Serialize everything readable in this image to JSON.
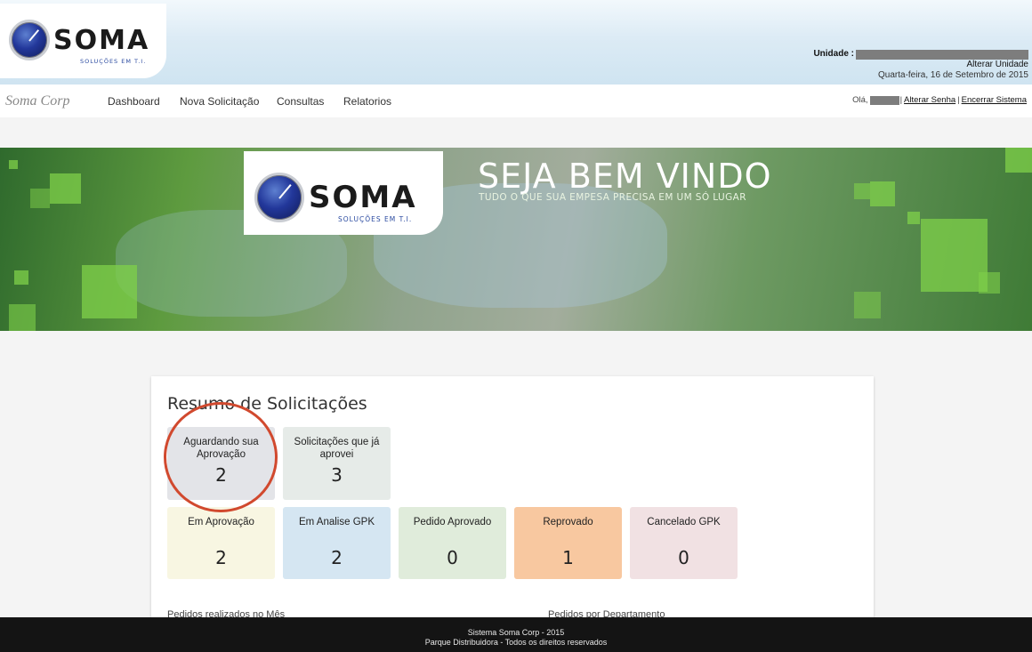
{
  "header": {
    "logo": {
      "word": "SOMA",
      "tagline": "SOLUÇÕES EM T.I."
    },
    "unit_label": "Unidade :",
    "change_unit": "Alterar Unidade",
    "date": "Quarta-feira, 16 de Setembro de 2015"
  },
  "nav": {
    "brand": "Soma Corp",
    "items": [
      {
        "label": "Dashboard"
      },
      {
        "label": "Nova Solicitação"
      },
      {
        "label": "Consultas"
      },
      {
        "label": "Relatorios"
      }
    ],
    "greeting": "Olá,",
    "separator": "|",
    "change_password": "Alterar Senha",
    "logout": "Encerrar Sistema"
  },
  "hero": {
    "logo": {
      "word": "SOMA",
      "tagline": "SOLUÇÕES EM T.I."
    },
    "title": "SEJA BEM VINDO",
    "subtitle": "TUDO O QUE SUA EMPESA PRECISA EM UM SÓ LUGAR"
  },
  "summary": {
    "title": "Resumo de Solicitações",
    "tiles": [
      {
        "label": "Aguardando sua Aprovação",
        "value": "2",
        "color": "#e3e4e8"
      },
      {
        "label": "Solicitações que já aprovei",
        "value": "3",
        "color": "#e6ebe8"
      },
      {
        "label": "Em Aprovação",
        "value": "2",
        "color": "#f8f6e2"
      },
      {
        "label": "Em Analise GPK",
        "value": "2",
        "color": "#d5e6f2"
      },
      {
        "label": "Pedido Aprovado",
        "value": "0",
        "color": "#e0ecdb"
      },
      {
        "label": "Reprovado",
        "value": "1",
        "color": "#f8c8a0"
      },
      {
        "label": "Cancelado GPK",
        "value": "0",
        "color": "#f1e1e3"
      }
    ],
    "section_month": "Pedidos realizados no Mês",
    "section_dept": "Pedidos por Departamento"
  },
  "footer": {
    "line1": "Sistema Soma Corp - 2015",
    "line2": "Parque Distribuidora - Todos os direitos reservados"
  },
  "colors": {
    "accent_ring": "#d1492e",
    "footer_bg": "#141414"
  }
}
